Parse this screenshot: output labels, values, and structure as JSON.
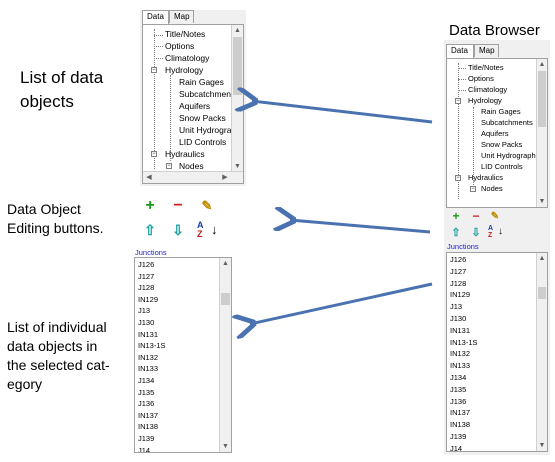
{
  "annotations": {
    "list_of_data_objects": [
      "List of data",
      "objects"
    ],
    "data_object_editing": [
      "Data Object",
      "Editing buttons."
    ],
    "list_of_individual": [
      "List of individual",
      "data objects in",
      "the selected cat-",
      "egory"
    ],
    "data_browser_title": "Data Browser"
  },
  "tabs": {
    "data": "Data",
    "map": "Map"
  },
  "tree": {
    "small": [
      "Title/Notes",
      "Options",
      "Climatology",
      "Hydrology",
      "Rain Gages",
      "Subcatchments",
      "Aquifers",
      "Snow Packs",
      "Unit Hydrograph",
      "LID Controls",
      "Hydraulics",
      "Nodes"
    ],
    "large": [
      "Title/Notes",
      "Options",
      "Climatology",
      "Hydrology",
      "Rain Gages",
      "Subcatchments",
      "Aquifers",
      "Snow Packs",
      "Unit Hydrograph",
      "LID Controls",
      "Hydraulics",
      "Nodes"
    ]
  },
  "category_label": "Junctions",
  "junctions_small": [
    "J126",
    "J127",
    "J128",
    "IN129",
    "J13",
    "J130",
    "IN131",
    "IN13-1S",
    "IN132",
    "IN133",
    "J134",
    "J135",
    "J136",
    "IN137",
    "IN138",
    "J139",
    "J14"
  ],
  "junctions_large": [
    "J126",
    "J127",
    "J128",
    "IN129",
    "J13",
    "J130",
    "IN131",
    "IN13-1S",
    "IN132",
    "IN133",
    "J134",
    "J135",
    "J136",
    "IN137",
    "IN138",
    "J139",
    "J14"
  ],
  "buttons": {
    "add": "+",
    "delete": "−",
    "edit": "✎",
    "up": "⇧",
    "down": "⇩",
    "sort_top": "A",
    "sort_bottom": "Z"
  },
  "colors": {
    "arrow": "#4a72b0",
    "add": "#1a9a1a",
    "delete": "#d42020",
    "updown": "#1aa0a0",
    "category": "#2020d0"
  }
}
